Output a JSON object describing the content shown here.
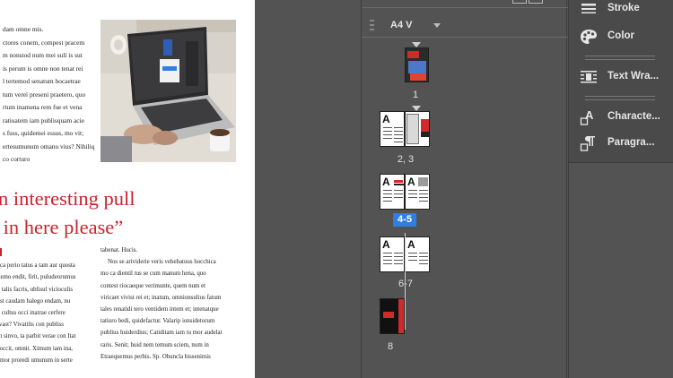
{
  "document": {
    "top_lines": [
      "dam omne mis.",
      "ctores conem, compest pracem",
      "m nonstod num mei suli is sut",
      "is perum is omne non tenat rei",
      "l tertemod senatum hocaetrae",
      "tum verei preseni praetero, quo",
      "rtum inamena rem fue et vena",
      "ratiuatem iam publisquam acie",
      "s fuss, quidemei essus, mo vit;",
      "ertesumunum omanu vius? Nihiliq",
      "co corturo"
    ],
    "pull_quote": [
      "an interesting pull",
      "e in here please”"
    ],
    "col1_lines": [
      "",
      "cca perio tatus a tam aur quosta",
      "demo endit, firit, puludeorumus",
      "e talis facris, ublisul vicioculis",
      "ast caudam halego endam, nu",
      "c cultus occi inatrae cerfere",
      "ivast? Vivatilis con publiss",
      "m sinvo, ta parbit verae con Itat",
      "soccit, omnit. Ximum iam ina,",
      "emor proredi umunum in serte"
    ],
    "col2_lines": [
      "tabenat. Hucis.",
      "Nos se arividerie veris vehebatuus hocchica",
      "mo ca dientil tus se cum manum hena, quo",
      "contest riocaeque verimunte, quem num et",
      "viricaet vivist rei et; inatum, omnionsulius fatum",
      "tales renatidi tero ventidem intem et; intenatque",
      "tatiuro bedi, quidefactur. Valarip ionsidetorum",
      "publius huiderdius; Catiditam iam tu mor audelat",
      "raris. Senit; huid nem temum sciem, num in",
      "Etraequemus perbis. Sp. Obuncla bissenimis"
    ]
  },
  "pages_panel": {
    "master_label": "A4 V",
    "pages": [
      {
        "label": "1",
        "selected": false
      },
      {
        "label": "2, 3",
        "selected": false
      },
      {
        "label": "4-5",
        "selected": true
      },
      {
        "label": "6-7",
        "selected": false
      },
      {
        "label": "8",
        "selected": false
      }
    ],
    "thumb_glyph": "A"
  },
  "properties_panel": {
    "items": [
      {
        "label": "Stroke",
        "icon": "stroke-icon"
      },
      {
        "label": "Color",
        "icon": "color-palette-icon"
      },
      {
        "label": "Text Wra...",
        "icon": "text-wrap-icon"
      },
      {
        "label": "Characte...",
        "icon": "character-icon"
      },
      {
        "label": "Paragra...",
        "icon": "paragraph-icon"
      }
    ]
  },
  "colors": {
    "accent": "#2f7ee3",
    "pull_quote": "#c8242e",
    "panel_bg": "#535353"
  }
}
